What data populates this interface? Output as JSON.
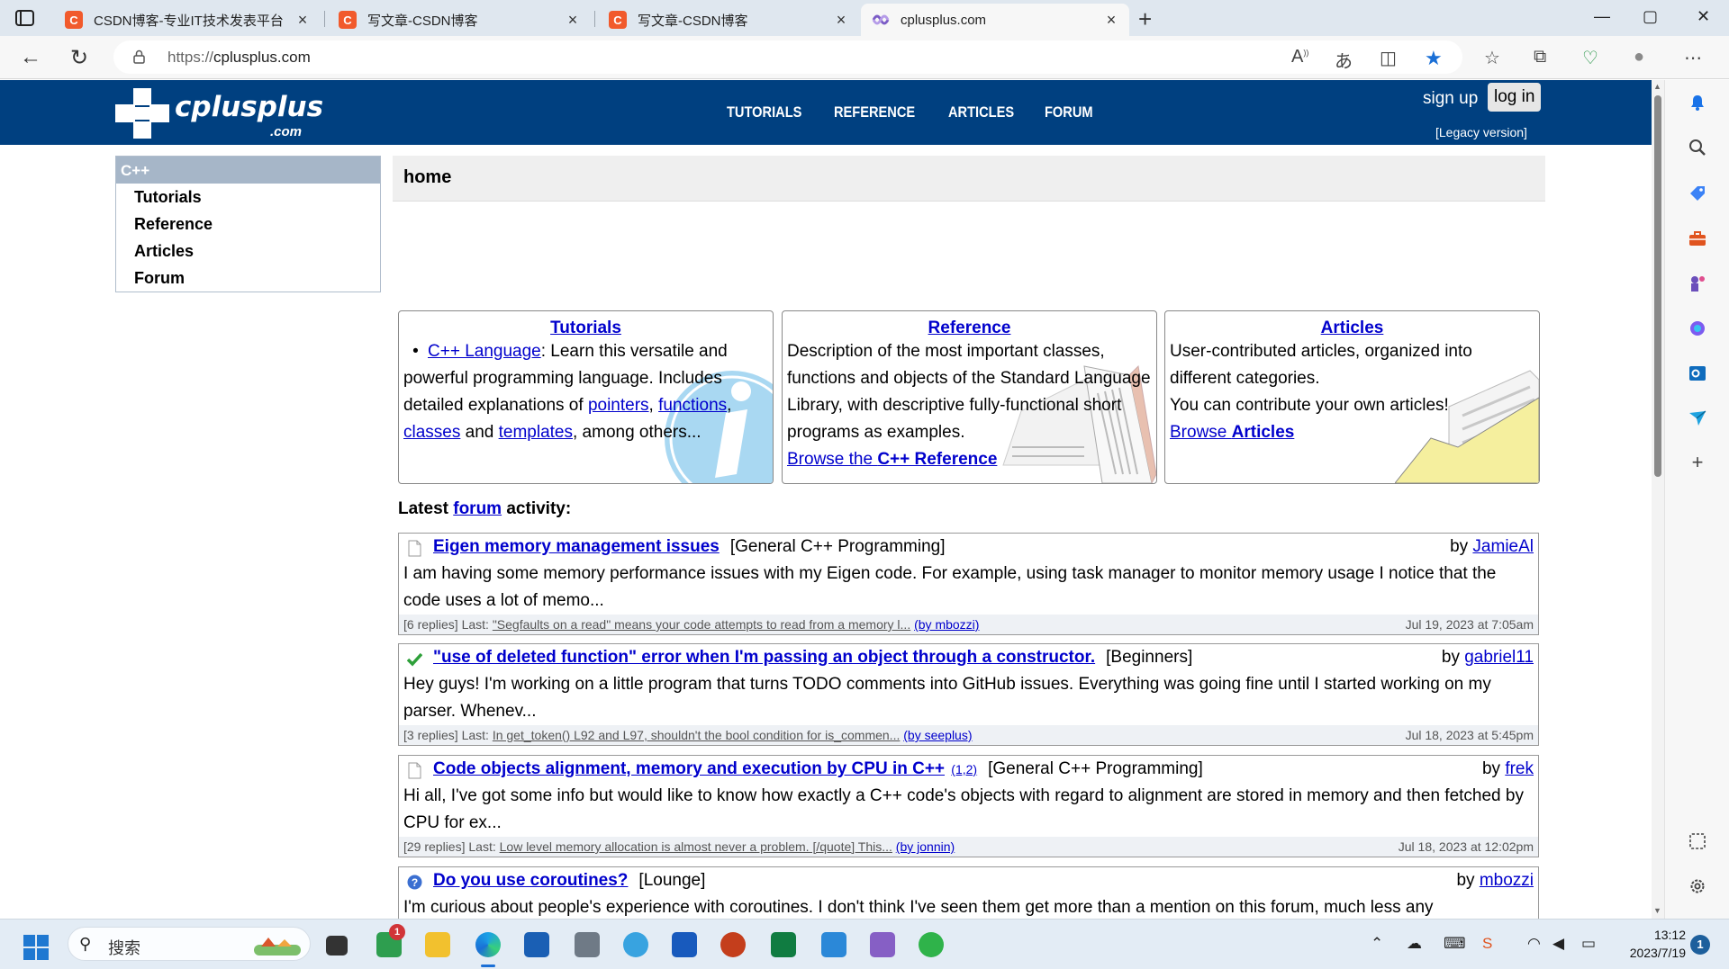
{
  "browser": {
    "tabs": [
      {
        "favicon": "C",
        "title": "CSDN博客-专业IT技术发表平台",
        "close": "×"
      },
      {
        "favicon": "C",
        "title": "写文章-CSDN博客",
        "close": "×"
      },
      {
        "favicon": "C",
        "title": "写文章-CSDN博客",
        "close": "×"
      },
      {
        "favicon": "cplusplus-logo",
        "title": "cplusplus.com",
        "close": "×"
      }
    ],
    "new_tab": "+",
    "window_controls": {
      "minimize": "—",
      "maximize": "▢",
      "close": "✕"
    },
    "address": {
      "scheme": "https://",
      "host": "cplusplus.com"
    },
    "icons": [
      "back-icon",
      "refresh-icon",
      "lock-icon",
      "read-aloud-icon",
      "translate-icon",
      "split-screen-icon",
      "favorite-star-icon",
      "favorites-icon",
      "collections-icon",
      "performance-icon",
      "profile-icon",
      "more-icon"
    ]
  },
  "site": {
    "logo_word": "cplusplus",
    "logo_com": ".com",
    "nav": [
      "TUTORIALS",
      "REFERENCE",
      "ARTICLES",
      "FORUM"
    ],
    "sign_up": "sign up",
    "log_in": "log in",
    "legacy": "[Legacy version]"
  },
  "leftnav": {
    "heading": "C++",
    "items": [
      "Tutorials",
      "Reference",
      "Articles",
      "Forum"
    ]
  },
  "breadcrumb": "home",
  "boxes": {
    "tutorials": {
      "title": "Tutorials",
      "link": "C++ Language",
      "text1": ": Learn this versatile and powerful programming language. Includes detailed explanations of ",
      "pointers": "pointers",
      "comma1": ", ",
      "functions": "functions",
      "comma2": ", ",
      "classes": "classes",
      "and": " and ",
      "templates": "templates",
      "tail": ", among others..."
    },
    "reference": {
      "title": "Reference",
      "text": "Description of the most important classes, functions and objects of the Standard Language Library, with descriptive fully-functional short programs as examples.",
      "browse_prefix": "Browse the ",
      "browse_bold": "C++ Reference"
    },
    "articles": {
      "title": "Articles",
      "text1": "User-contributed articles, organized into different categories.",
      "text2": "You can contribute your own articles!",
      "browse_prefix": "Browse ",
      "browse_bold": "Articles"
    }
  },
  "latest": {
    "prefix": "Latest ",
    "link": "forum",
    "suffix": " activity:"
  },
  "posts": [
    {
      "icon": "document-icon",
      "title": "Eigen memory management issues",
      "pages": "",
      "category": "[General C++ Programming]",
      "by": "by ",
      "author": "JamieAl",
      "body": "I am having some memory performance issues with my Eigen code. For example, using task manager to monitor memory usage I notice that the code uses a lot of memo...",
      "replies": "[6 replies] Last: ",
      "last": "\"Segfaults on a read\" means your code attempts to read from a memory l...",
      "last_by": "(by mbozzi)",
      "date": "Jul 19, 2023 at 7:05am"
    },
    {
      "icon": "check-icon",
      "title": "\"use of deleted function\" error when I'm passing an object through a constructor.",
      "pages": "",
      "category": "[Beginners]",
      "by": "by ",
      "author": "gabriel11",
      "body": "Hey guys! I'm working on a little program that turns TODO comments into GitHub issues. Everything was going fine until I started working on my parser. Whenev...",
      "replies": "[3 replies] Last: ",
      "last": "In get_token() L92 and L97, shouldn't the bool condition for is_commen...",
      "last_by": "(by seeplus)",
      "date": "Jul 18, 2023 at 5:45pm"
    },
    {
      "icon": "document-icon",
      "title": "Code objects alignment, memory and execution by CPU in C++",
      "pages": "(1,2)",
      "category": "[General C++ Programming]",
      "by": "by ",
      "author": "frek",
      "body": "Hi all, I've got some info but would like to know how exactly a C++ code's objects with regard to alignment are stored in memory and then fetched by CPU for ex...",
      "replies": "[29 replies] Last: ",
      "last": "Low level memory allocation is almost never a problem. [/quote] This...",
      "last_by": "(by jonnin)",
      "date": "Jul 18, 2023 at 12:02pm"
    },
    {
      "icon": "question-icon",
      "title": "Do you use coroutines?",
      "pages": "",
      "category": "[Lounge]",
      "by": "by ",
      "author": "mbozzi",
      "body": "I'm curious about people's experience with coroutines. I don't think I've seen them get more than a mention on this forum, much less any",
      "replies": "",
      "last": "",
      "last_by": "",
      "date": ""
    }
  ],
  "taskbar": {
    "search_placeholder": "搜索",
    "badge": "1",
    "time": "13:12",
    "date": "2023/7/19",
    "notifications": "1"
  }
}
